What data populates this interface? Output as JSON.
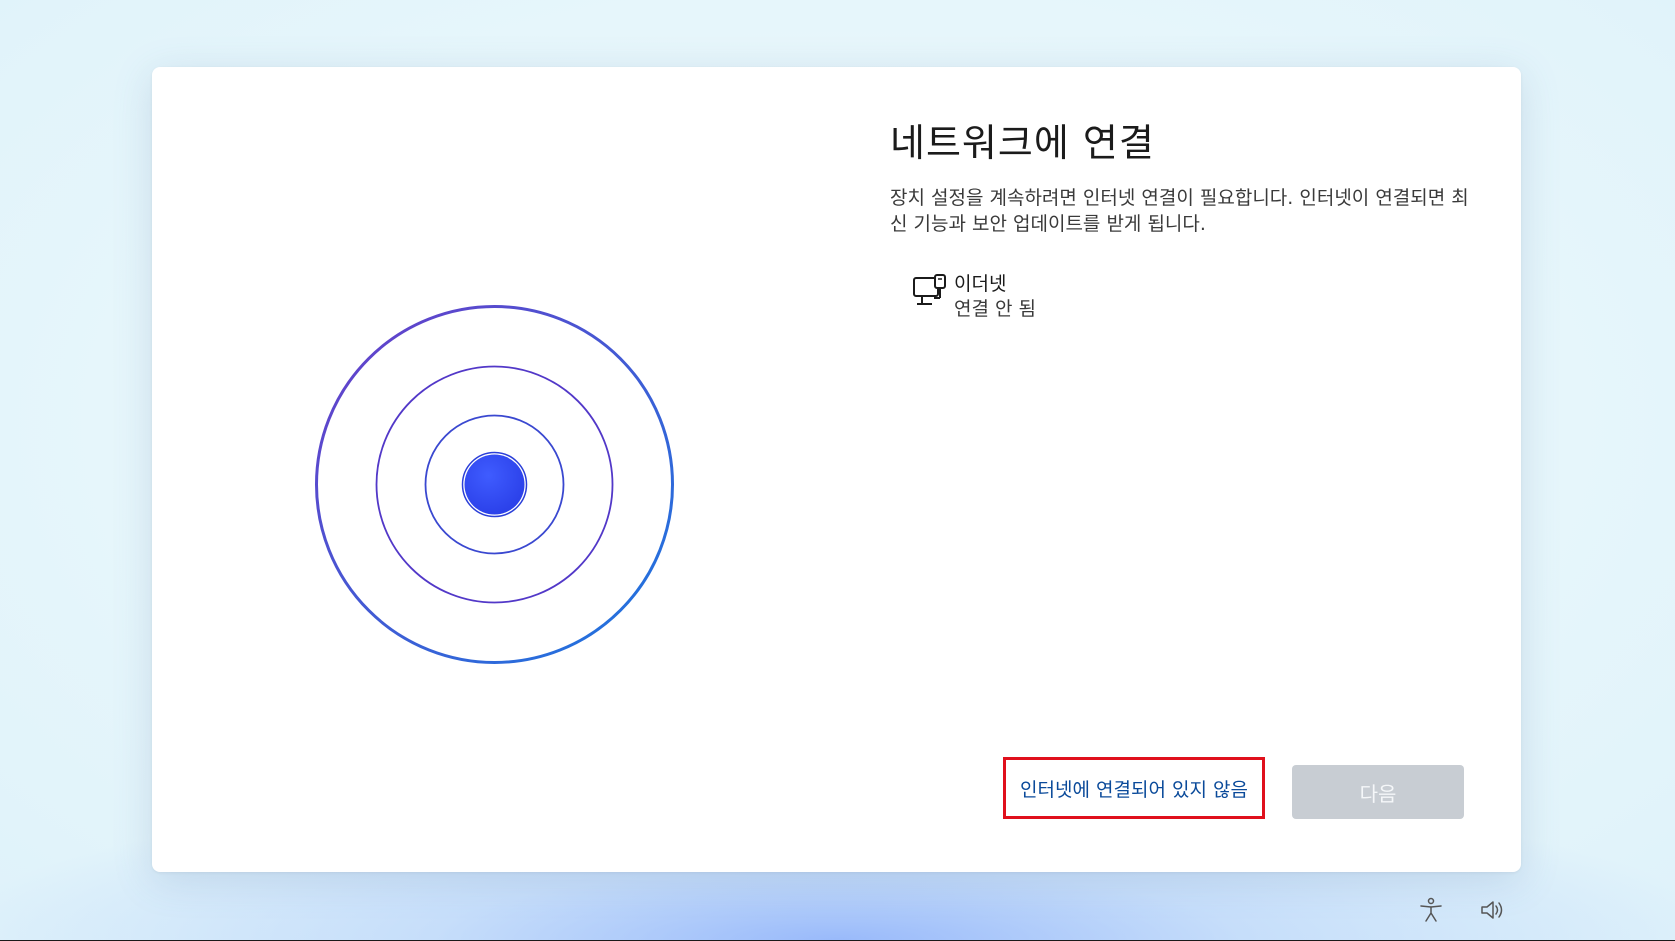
{
  "dialog": {
    "title": "네트워크에 연결",
    "description": "장치 설정을 계속하려면 인터넷 연결이 필요합니다. 인터넷이 연결되면 최신 기능과 보안 업데이트를 받게 됩니다.",
    "network": {
      "icon": "wired-network-icon",
      "name": "이더넷",
      "status": "연결 안 됨"
    },
    "no_internet_label": "인터넷에 연결되어 있지 않음",
    "next_label": "다음"
  },
  "taskbar": {
    "accessibility_icon": "accessibility-icon",
    "volume_icon": "volume-icon"
  },
  "colors": {
    "ring_purple": "#5a3fd0",
    "ring_blue": "#1f6fe0",
    "dot_blue": "#2f4cf5",
    "highlight_red": "#e0101c",
    "link_blue": "#0a4a9a",
    "button_disabled": "#c8cdd3"
  }
}
